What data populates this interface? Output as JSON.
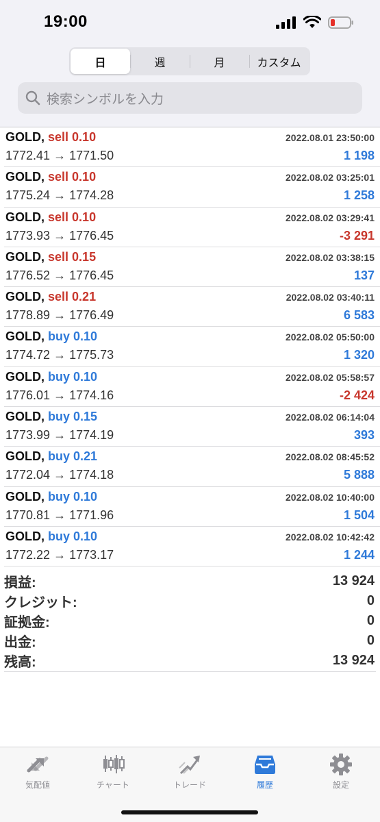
{
  "status_bar": {
    "time": "19:00"
  },
  "period_tabs": [
    {
      "label": "日",
      "active": true
    },
    {
      "label": "週",
      "active": false
    },
    {
      "label": "月",
      "active": false
    },
    {
      "label": "カスタム",
      "active": false
    }
  ],
  "search": {
    "placeholder": "検索シンボルを入力"
  },
  "deals": [
    {
      "symbol": "GOLD,",
      "side": "sell",
      "volume": "sell 0.10",
      "prices": "1772.41 → 1771.50",
      "time": "2022.08.01 23:50:00",
      "profit": "1 198",
      "sign": "pos"
    },
    {
      "symbol": "GOLD,",
      "side": "sell",
      "volume": "sell 0.10",
      "prices": "1775.24 → 1774.28",
      "time": "2022.08.02 03:25:01",
      "profit": "1 258",
      "sign": "pos"
    },
    {
      "symbol": "GOLD,",
      "side": "sell",
      "volume": "sell 0.10",
      "prices": "1773.93 → 1776.45",
      "time": "2022.08.02 03:29:41",
      "profit": "-3 291",
      "sign": "neg"
    },
    {
      "symbol": "GOLD,",
      "side": "sell",
      "volume": "sell 0.15",
      "prices": "1776.52 → 1776.45",
      "time": "2022.08.02 03:38:15",
      "profit": "137",
      "sign": "pos"
    },
    {
      "symbol": "GOLD,",
      "side": "sell",
      "volume": "sell 0.21",
      "prices": "1778.89 → 1776.49",
      "time": "2022.08.02 03:40:11",
      "profit": "6 583",
      "sign": "pos"
    },
    {
      "symbol": "GOLD,",
      "side": "buy",
      "volume": "buy 0.10",
      "prices": "1774.72 → 1775.73",
      "time": "2022.08.02 05:50:00",
      "profit": "1 320",
      "sign": "pos"
    },
    {
      "symbol": "GOLD,",
      "side": "buy",
      "volume": "buy 0.10",
      "prices": "1776.01 → 1774.16",
      "time": "2022.08.02 05:58:57",
      "profit": "-2 424",
      "sign": "neg"
    },
    {
      "symbol": "GOLD,",
      "side": "buy",
      "volume": "buy 0.15",
      "prices": "1773.99 → 1774.19",
      "time": "2022.08.02 06:14:04",
      "profit": "393",
      "sign": "pos"
    },
    {
      "symbol": "GOLD,",
      "side": "buy",
      "volume": "buy 0.21",
      "prices": "1772.04 → 1774.18",
      "time": "2022.08.02 08:45:52",
      "profit": "5 888",
      "sign": "pos"
    },
    {
      "symbol": "GOLD,",
      "side": "buy",
      "volume": "buy 0.10",
      "prices": "1770.81 → 1771.96",
      "time": "2022.08.02 10:40:00",
      "profit": "1 504",
      "sign": "pos"
    },
    {
      "symbol": "GOLD,",
      "side": "buy",
      "volume": "buy 0.10",
      "prices": "1772.22 → 1773.17",
      "time": "2022.08.02 10:42:42",
      "profit": "1 244",
      "sign": "pos"
    }
  ],
  "summary": [
    {
      "label": "損益:",
      "value": "13 924"
    },
    {
      "label": "クレジット:",
      "value": "0"
    },
    {
      "label": "証拠金:",
      "value": "0"
    },
    {
      "label": "出金:",
      "value": "0"
    },
    {
      "label": "残高:",
      "value": "13 924"
    }
  ],
  "tabbar": [
    {
      "label": "気配値",
      "icon": "quotes-icon",
      "active": false
    },
    {
      "label": "チャート",
      "icon": "chart-icon",
      "active": false
    },
    {
      "label": "トレード",
      "icon": "trade-icon",
      "active": false
    },
    {
      "label": "履歴",
      "icon": "history-icon",
      "active": true
    },
    {
      "label": "設定",
      "icon": "settings-icon",
      "active": false
    }
  ],
  "colors": {
    "sell": "#c8372d",
    "buy": "#2f7ad9",
    "negative": "#c8372d",
    "positive": "#2f7ad9",
    "tab_active": "#2f7ad9",
    "tab_inactive": "#8e8e93"
  }
}
